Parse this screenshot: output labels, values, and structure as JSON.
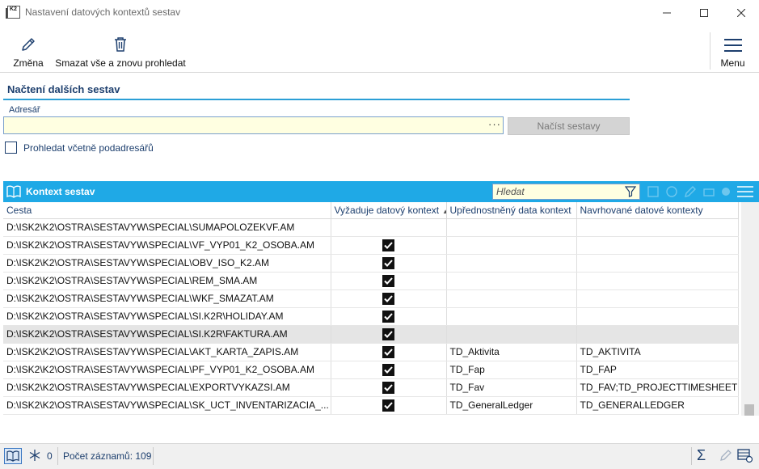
{
  "window": {
    "title": "Nastavení datových kontextů sestav",
    "app_icon_text": "K2"
  },
  "toolbar": {
    "change_label": "Změna",
    "delete_rescan_label": "Smazat vše a znovu prohledat",
    "menu_label": "Menu"
  },
  "load_section": {
    "title": "Načtení dalších sestav",
    "address_label": "Adresář",
    "address_value": "",
    "browse_dots": "···",
    "load_button_label": "Načíst sestavy",
    "include_subdirs_label": "Prohledat včetně podadresářů",
    "include_subdirs_checked": false
  },
  "grid": {
    "title": "Kontext sestav",
    "search_placeholder": "Hledat",
    "columns": {
      "path": "Cesta",
      "requires": "Vyžaduje datový kontext",
      "preferred": "Upřednostněný data kontext",
      "suggested": "Navrhované datové kontexty"
    },
    "rows": [
      {
        "path": "D:\\ISK2\\K2\\OSTRA\\SESTAVYW\\SPECIAL\\SUMAPOLOZEKVF.AM",
        "requires": false,
        "preferred": "",
        "suggested": ""
      },
      {
        "path": "D:\\ISK2\\K2\\OSTRA\\SESTAVYW\\SPECIAL\\VF_VYP01_K2_OSOBA.AM",
        "requires": true,
        "preferred": "",
        "suggested": ""
      },
      {
        "path": "D:\\ISK2\\K2\\OSTRA\\SESTAVYW\\SPECIAL\\OBV_ISO_K2.AM",
        "requires": true,
        "preferred": "",
        "suggested": ""
      },
      {
        "path": "D:\\ISK2\\K2\\OSTRA\\SESTAVYW\\SPECIAL\\REM_SMA.AM",
        "requires": true,
        "preferred": "",
        "suggested": ""
      },
      {
        "path": "D:\\ISK2\\K2\\OSTRA\\SESTAVYW\\SPECIAL\\WKF_SMAZAT.AM",
        "requires": true,
        "preferred": "",
        "suggested": ""
      },
      {
        "path": "D:\\ISK2\\K2\\OSTRA\\SESTAVYW\\SPECIAL\\SI.K2R\\HOLIDAY.AM",
        "requires": true,
        "preferred": "",
        "suggested": ""
      },
      {
        "path": "D:\\ISK2\\K2\\OSTRA\\SESTAVYW\\SPECIAL\\SI.K2R\\FAKTURA.AM",
        "requires": true,
        "preferred": "",
        "suggested": "",
        "selected": true
      },
      {
        "path": "D:\\ISK2\\K2\\OSTRA\\SESTAVYW\\SPECIAL\\AKT_KARTA_ZAPIS.AM",
        "requires": true,
        "preferred": "TD_Aktivita",
        "suggested": "TD_AKTIVITA"
      },
      {
        "path": "D:\\ISK2\\K2\\OSTRA\\SESTAVYW\\SPECIAL\\PF_VYP01_K2_OSOBA.AM",
        "requires": true,
        "preferred": "TD_Fap",
        "suggested": "TD_FAP"
      },
      {
        "path": "D:\\ISK2\\K2\\OSTRA\\SESTAVYW\\SPECIAL\\EXPORTVYKAZSI.AM",
        "requires": true,
        "preferred": "TD_Fav",
        "suggested": "TD_FAV;TD_PROJECTTIMESHEET"
      },
      {
        "path": "D:\\ISK2\\K2\\OSTRA\\SESTAVYW\\SPECIAL\\SK_UCT_INVENTARIZACIA_...",
        "requires": true,
        "preferred": "TD_GeneralLedger",
        "suggested": "TD_GENERALLEDGER"
      }
    ]
  },
  "statusbar": {
    "filter_count": "0",
    "record_count_label": "Počet záznamů: 109",
    "sigma": "Σ"
  },
  "colors": {
    "accent": "#1fa9e6",
    "label_blue": "#1d3f6e",
    "input_bg": "#ffffe1",
    "selected_row": "#e5e5e5"
  }
}
